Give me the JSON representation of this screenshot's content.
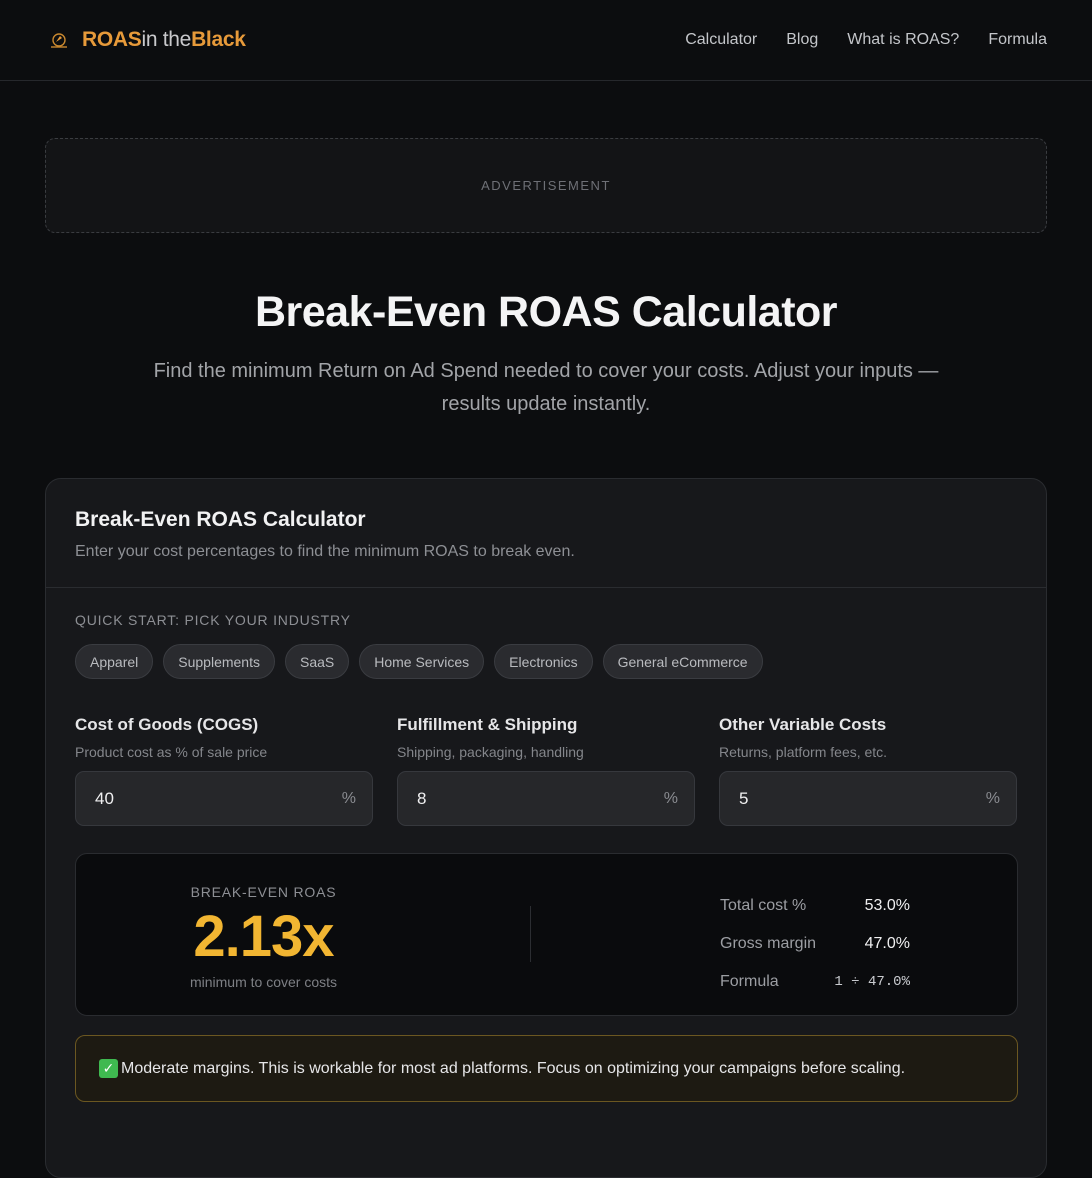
{
  "header": {
    "brand": {
      "part1": "ROAS",
      "part2": "in the",
      "part3": "Black"
    },
    "nav": [
      "Calculator",
      "Blog",
      "What is ROAS?",
      "Formula"
    ]
  },
  "ad": {
    "label": "ADVERTISEMENT"
  },
  "hero": {
    "title": "Break-Even ROAS Calculator",
    "subtitle": "Find the minimum Return on Ad Spend needed to cover your costs. Adjust your inputs — results update instantly."
  },
  "card": {
    "title": "Break-Even ROAS Calculator",
    "description": "Enter your cost percentages to find the minimum ROAS to break even.",
    "quick_start_label": "QUICK START: PICK YOUR INDUSTRY",
    "industries": [
      "Apparel",
      "Supplements",
      "SaaS",
      "Home Services",
      "Electronics",
      "General eCommerce"
    ],
    "fields": [
      {
        "label": "Cost of Goods (COGS)",
        "help": "Product cost as % of sale price",
        "value": "40",
        "unit": "%"
      },
      {
        "label": "Fulfillment & Shipping",
        "help": "Shipping, packaging, handling",
        "value": "8",
        "unit": "%"
      },
      {
        "label": "Other Variable Costs",
        "help": "Returns, platform fees, etc.",
        "value": "5",
        "unit": "%"
      }
    ],
    "result": {
      "label": "BREAK-EVEN ROAS",
      "value": "2.13x",
      "note": "minimum to cover costs",
      "stats": [
        {
          "key": "Total cost %",
          "value": "53.0%"
        },
        {
          "key": "Gross margin",
          "value": "47.0%"
        },
        {
          "key": "Formula",
          "value": "1 ÷ 47.0%"
        }
      ]
    },
    "notice": "Moderate margins. This is workable for most ad platforms. Focus on optimizing your campaigns before scaling."
  },
  "colors": {
    "accent": "#e79a3a",
    "result": "#f2b632",
    "notice_border": "#6b5721"
  }
}
